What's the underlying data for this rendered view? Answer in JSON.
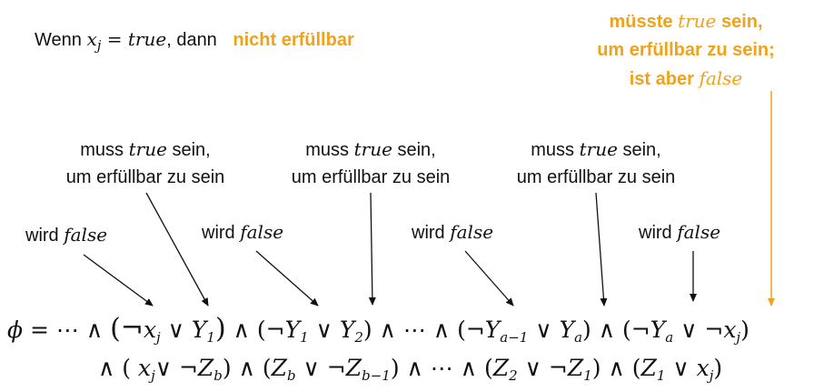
{
  "header": {
    "prefix": "Wenn ",
    "var": "x",
    "var_sub": "j",
    "eq": " = ",
    "value": "true",
    "suffix": ", dann",
    "result": "nicht erfüllbar"
  },
  "orange_note": {
    "line1_a": "müsste ",
    "line1_math": "true",
    "line1_b": " sein,",
    "line2": "um erfüllbar zu sein;",
    "line3_a": "ist aber ",
    "line3_math": "false"
  },
  "must_notes": [
    {
      "line1_a": "muss ",
      "line1_math": "true",
      "line1_b": " sein,",
      "line2": "um erfüllbar zu sein"
    },
    {
      "line1_a": "muss ",
      "line1_math": "true",
      "line1_b": " sein,",
      "line2": "um erfüllbar zu sein"
    },
    {
      "line1_a": "muss ",
      "line1_math": "true",
      "line1_b": " sein,",
      "line2": "um erfüllbar zu sein"
    }
  ],
  "wird_notes": [
    {
      "text": "wird ",
      "math": "false"
    },
    {
      "text": "wird ",
      "math": "false"
    },
    {
      "text": "wird ",
      "math": "false"
    },
    {
      "text": "wird ",
      "math": "false"
    }
  ],
  "formula": {
    "line1": [
      {
        "t": "ϕ",
        "v": true
      },
      {
        "t": " = ⋯ ∧ "
      },
      {
        "t": "(¬",
        "big": true
      },
      {
        "t": "x",
        "v": true
      },
      {
        "t": "j",
        "sub": true
      },
      {
        "t": " ∨ "
      },
      {
        "t": "Y",
        "v": true
      },
      {
        "t": "1",
        "sub": true
      },
      {
        "t": ")",
        "big": true
      },
      {
        "t": " ∧ (¬"
      },
      {
        "t": "Y",
        "v": true
      },
      {
        "t": "1",
        "sub": true
      },
      {
        "t": " ∨ "
      },
      {
        "t": "Y",
        "v": true
      },
      {
        "t": "2",
        "sub": true
      },
      {
        "t": ")"
      },
      {
        "t": " ∧ ⋯ ∧ (¬"
      },
      {
        "t": "Y",
        "v": true
      },
      {
        "t": "a−1",
        "sub": true
      },
      {
        "t": " ∨ "
      },
      {
        "t": "Y",
        "v": true
      },
      {
        "t": "a",
        "sub": true
      },
      {
        "t": ")"
      },
      {
        "t": " ∧ (¬"
      },
      {
        "t": "Y",
        "v": true
      },
      {
        "t": "a",
        "sub": true
      },
      {
        "t": " ∨ ¬"
      },
      {
        "t": "x",
        "v": true
      },
      {
        "t": "j",
        "sub": true
      },
      {
        "t": ")"
      }
    ],
    "line2": [
      {
        "t": "∧ (  "
      },
      {
        "t": "x",
        "v": true
      },
      {
        "t": "j",
        "sub": true
      },
      {
        "t": "∨ ¬"
      },
      {
        "t": "Z",
        "v": true
      },
      {
        "t": "b",
        "sub": true
      },
      {
        "t": ")"
      },
      {
        "t": " ∧ ("
      },
      {
        "t": "Z",
        "v": true
      },
      {
        "t": "b",
        "sub": true
      },
      {
        "t": " ∨ ¬"
      },
      {
        "t": "Z",
        "v": true
      },
      {
        "t": "b−1",
        "sub": true
      },
      {
        "t": ")"
      },
      {
        "t": " ∧ ⋯ ∧ ("
      },
      {
        "t": "Z",
        "v": true
      },
      {
        "t": "2",
        "sub": true
      },
      {
        "t": " ∨ ¬"
      },
      {
        "t": "Z",
        "v": true
      },
      {
        "t": "1",
        "sub": true
      },
      {
        "t": ")"
      },
      {
        "t": " ∧ ("
      },
      {
        "t": "Z",
        "v": true
      },
      {
        "t": "1",
        "sub": true
      },
      {
        "t": " ∨  "
      },
      {
        "t": "x",
        "v": true
      },
      {
        "t": "j",
        "sub": true
      },
      {
        "t": ")"
      }
    ]
  },
  "colors": {
    "accent": "#F0A21A",
    "text": "#111111",
    "arrow": "#111111"
  }
}
